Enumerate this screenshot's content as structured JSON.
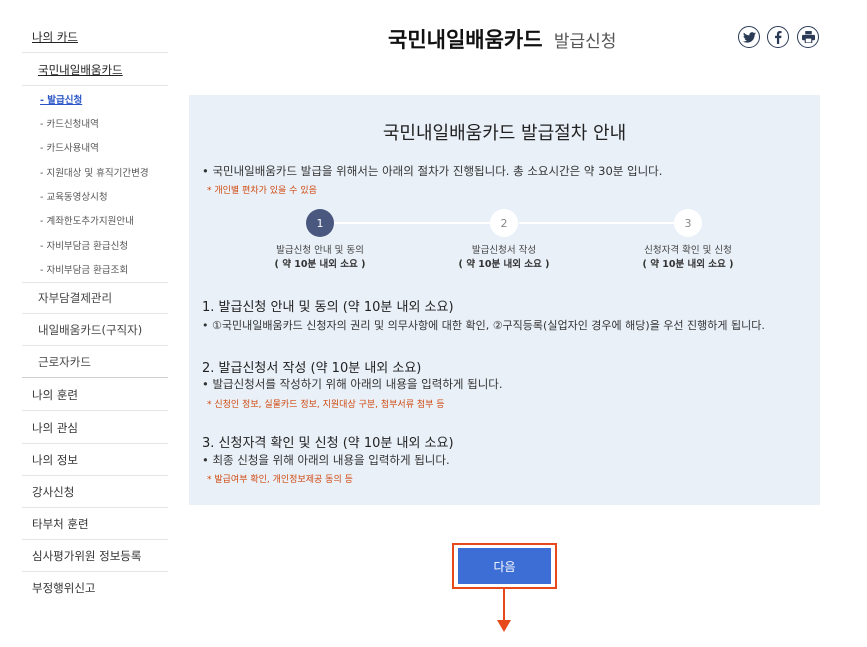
{
  "sidebar": {
    "top_label": "나의 카드",
    "sub_label": "국민내일배움카드",
    "items": [
      "- 발급신청",
      "- 카드신청내역",
      "- 카드사용내역",
      "- 지원대상 및 휴직기간변경",
      "- 교육동영상시청",
      "- 계좌한도추가지원안내",
      "- 자비부담금 환급신청",
      "- 자비부담금 환급조회"
    ],
    "level2": [
      "자부담결제관리",
      "내일배움카드(구직자)",
      "근로자카드"
    ],
    "level1": [
      "나의 훈련",
      "나의 관심",
      "나의 정보",
      "강사신청",
      "타부처 훈련",
      "심사평가위원 정보등록",
      "부정행위신고"
    ]
  },
  "header": {
    "title": "국민내일배움카드",
    "subtitle": "발급신청"
  },
  "panel": {
    "title": "국민내일배움카드 발급절차 안내",
    "intro": "• 국민내일배움카드 발급을 위해서는 아래의 절차가 진행됩니다. 총 소요시간은 약 30분 입니다.",
    "intro_note": "* 개인별 편차가 있을 수 있음",
    "steps": [
      {
        "num": "1",
        "label": "발급신청 안내 및 동의",
        "time": "( 약 10분 내외 소요 )"
      },
      {
        "num": "2",
        "label": "발급신청서 작성",
        "time": "( 약 10분 내외 소요 )"
      },
      {
        "num": "3",
        "label": "신청자격 확인 및 신청",
        "time": "( 약 10분 내외 소요 )"
      }
    ],
    "sections": [
      {
        "title": "1. 발급신청 안내 및 동의 (약 10분 내외 소요)",
        "body": "• ①국민내일배움카드 신청자의 권리 및 의무사항에 대한 확인, ②구직등록(실업자인 경우에 해당)을 우선 진행하게 됩니다.",
        "note": ""
      },
      {
        "title": "2. 발급신청서 작성 (약 10분 내외 소요)",
        "body": "• 발급신청서를 작성하기 위해 아래의 내용을 입력하게 됩니다.",
        "note": "* 신청인 정보, 실물카드 정보, 지원대상 구분, 첨부서류 첨부 등"
      },
      {
        "title": "3. 신청자격 확인 및 신청 (약 10분 내외 소요)",
        "body": "• 최종 신청을 위해 아래의 내용을 입력하게 됩니다.",
        "note": "* 발급여부 확인, 개인정보제공 동의 등"
      }
    ]
  },
  "next_button": "다음",
  "share_icons": [
    "twitter-icon",
    "facebook-icon",
    "print-icon"
  ],
  "colors": {
    "accent": "#3c6ed6",
    "highlight": "#e8491a",
    "panel_bg": "#e9f0f8",
    "step_active": "#4a5880",
    "note": "#d04a10"
  }
}
